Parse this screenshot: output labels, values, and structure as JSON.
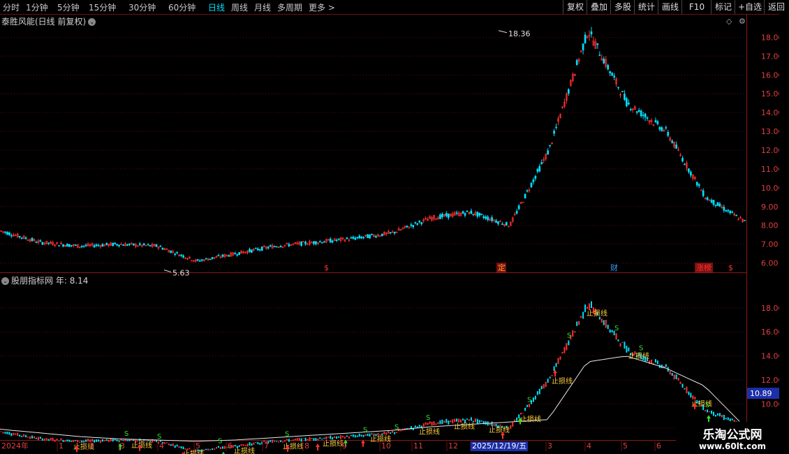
{
  "toolbar": {
    "periods": [
      "分时",
      "1分钟",
      "5分钟",
      "15分钟",
      "30分钟",
      "60分钟",
      "日线",
      "周线",
      "月线",
      "多周期",
      "更多 >"
    ],
    "active_period": "日线",
    "buttons": [
      "复权",
      "叠加",
      "多股",
      "统计",
      "画线",
      "F10",
      "标记",
      "+自选",
      "返回"
    ]
  },
  "main_chart": {
    "title": "泰胜风能(日线 前复权)",
    "high_label": "18.36",
    "low_label": "5.63",
    "y_ticks": [
      "18.00",
      "17.00",
      "16.00",
      "15.00",
      "14.00",
      "13.00",
      "12.00",
      "11.00",
      "10.00",
      "9.00",
      "8.00",
      "7.00",
      "6.00"
    ],
    "event_markers": [
      "$",
      "定",
      "财",
      "涨榜",
      "$"
    ]
  },
  "indicator_chart": {
    "title": "股朋指标网",
    "value_label": "年: 8.14",
    "y_ticks": [
      "18.00",
      "16.00",
      "14.00",
      "12.00",
      "10.00",
      "8.00"
    ],
    "current_value": "10.89",
    "stop_loss_label": "止损线",
    "signal_label": "S"
  },
  "time_axis": {
    "year": "2024年",
    "months": [
      "1",
      "2",
      "3",
      "4",
      "5",
      "6",
      "7",
      "8",
      "9",
      "10",
      "11",
      "12",
      "2025/12/19/五",
      "3",
      "4",
      "5",
      "6"
    ],
    "highlight": "2025/12/19/五"
  },
  "watermark": {
    "line1": "乐淘公式网",
    "line2": "www.60lt.com"
  },
  "colors": {
    "up": "#ff3030",
    "down": "#00e0ff",
    "grid": "#5a0e0e",
    "signal_yellow": "#ffd040",
    "signal_green": "#30e030",
    "highlight_bg": "#1c2fa8"
  },
  "chart_data": [
    {
      "type": "line",
      "title": "泰胜风能(日线 前复权)",
      "ylim": [
        5.5,
        18.5
      ],
      "x": [
        "2024-11",
        "2024-12",
        "2025-01",
        "2025-02",
        "2025-03",
        "2025-04",
        "2025-05",
        "2025-06",
        "2025-07",
        "2025-08",
        "2025-09",
        "2025-10",
        "2025-11",
        "2025-12",
        "2026-01",
        "2026-02",
        "2026-03",
        "2026-04",
        "2026-05",
        "2026-06"
      ],
      "series": [
        {
          "values": [
            7.7,
            7.1,
            6.9,
            7.0,
            6.9,
            6.1,
            6.5,
            6.9,
            7.1,
            7.3,
            7.6,
            8.4,
            8.7,
            8.0,
            12.0,
            18.36,
            14.5,
            13.0,
            9.5,
            8.2
          ]
        }
      ]
    },
    {
      "type": "line",
      "title": "股朋指标网",
      "ylim": [
        7.0,
        19.5
      ],
      "x": [
        "2024-11",
        "2024-12",
        "2025-01",
        "2025-02",
        "2025-03",
        "2025-04",
        "2025-05",
        "2025-06",
        "2025-07",
        "2025-08",
        "2025-09",
        "2025-10",
        "2025-11",
        "2025-12",
        "2026-01",
        "2026-02",
        "2026-03",
        "2026-04",
        "2026-05",
        "2026-06"
      ],
      "series": [
        {
          "values": [
            7.7,
            7.4,
            7.1,
            6.9,
            6.9,
            6.7,
            6.9,
            7.2,
            7.4,
            7.7,
            8.0,
            8.4,
            8.6,
            8.0,
            12.0,
            17.5,
            14.5,
            12.5,
            9.6,
            8.14
          ]
        },
        {
          "values": [
            7.9,
            7.6,
            7.3,
            7.1,
            7.0,
            6.9,
            7.0,
            7.2,
            7.4,
            7.6,
            7.8,
            8.1,
            8.3,
            8.5,
            8.7,
            13.5,
            14.0,
            13.0,
            11.5,
            8.2
          ]
        }
      ]
    }
  ]
}
